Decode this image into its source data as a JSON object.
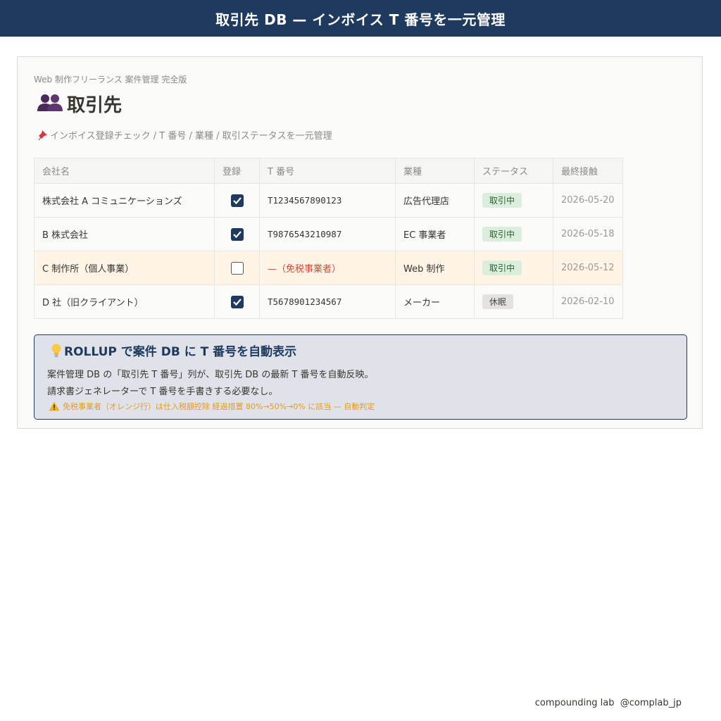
{
  "banner": {
    "title": "取引先 DB — インボイス T 番号を一元管理"
  },
  "page": {
    "breadcrumb": "Web 制作フリーランス 案件管理 完全版",
    "icon": "people-icon",
    "title": "取引先",
    "subtitle_icon": "pin-icon",
    "subtitle": "インボイス登録チェック / T 番号 / 業種 / 取引ステータスを一元管理"
  },
  "table": {
    "headers": {
      "company": "会社名",
      "registered": "登録",
      "t_number": "T 番号",
      "industry": "業種",
      "status": "ステータス",
      "last_contact": "最終接触"
    },
    "rows": [
      {
        "company": "株式会社 A コミュニケーションズ",
        "registered": true,
        "t_number": "T1234567890123",
        "industry": "広告代理店",
        "status": "取引中",
        "last_contact": "2026-05-20"
      },
      {
        "company": "B 株式会社",
        "registered": true,
        "t_number": "T9876543210987",
        "industry": "EC 事業者",
        "status": "取引中",
        "last_contact": "2026-05-18"
      },
      {
        "company": "C 制作所（個人事業）",
        "registered": false,
        "t_number": "—（免税事業者）",
        "industry": "Web 制作",
        "status": "取引中",
        "last_contact": "2026-05-12"
      },
      {
        "company": "D 社（旧クライアント）",
        "registered": true,
        "t_number": "T5678901234567",
        "industry": "メーカー",
        "status": "休眠",
        "last_contact": "2026-02-10"
      }
    ]
  },
  "callout": {
    "icon": "lightbulb-icon",
    "title": "ROLLUP で案件 DB に T 番号を自動表示",
    "line1": "案件管理 DB の「取引先 T 番号」列が、取引先 DB の最新 T 番号を自動反映。",
    "line2": "請求書ジェネレーターで T 番号を手書きする必要なし。",
    "warning_icon": "warning-icon",
    "warning": "免税事業者（オレンジ行）は仕入税額控除 経過措置 80%→50%→0% に該当 — 自動判定"
  },
  "footer": {
    "text": "compounding lab  @complab_jp"
  },
  "colors": {
    "navy": "#1f3a5f",
    "orange_row": "#fff4e6",
    "warning": "#e69a1e",
    "exempt_red": "#d04a3a",
    "badge_active": "#dbeddb",
    "badge_dormant": "#e3e2e0"
  }
}
